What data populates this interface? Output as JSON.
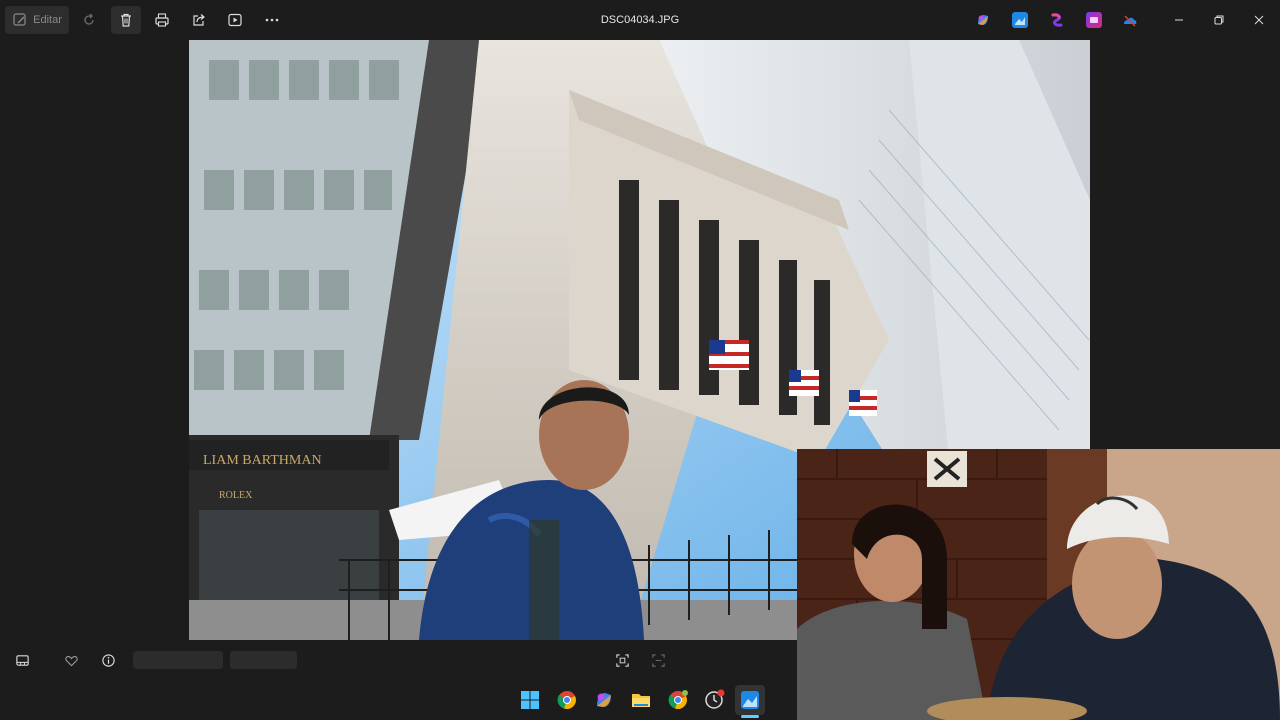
{
  "toolbar": {
    "edit_label": "Editar",
    "items": [
      "pencil-icon",
      "rotate-icon",
      "delete-icon",
      "print-icon",
      "share-icon",
      "slideshow-icon",
      "more-icon"
    ]
  },
  "window": {
    "title": "DSC04034.JPG",
    "app_icons": [
      "copilot-icon",
      "photos-icon",
      "clipchamp-icon",
      "designer-icon",
      "onedrive-icon"
    ]
  },
  "photo": {
    "store_sign": "LIAM BARTHMAN",
    "brand_sign": "ROLEX"
  },
  "bottombar": {
    "icons": [
      "filmstrip-icon",
      "favorite-icon",
      "info-icon",
      "fit-icon",
      "fullscreen-icon"
    ]
  },
  "taskbar": {
    "icons": [
      "windows-start-icon",
      "chrome-icon",
      "copilot-icon",
      "file-explorer-icon",
      "chrome-icon",
      "clock-icon",
      "photos-icon"
    ],
    "active": "photos-icon"
  },
  "colors": {
    "background": "#1c1c1c",
    "accent": "#60cdff"
  }
}
